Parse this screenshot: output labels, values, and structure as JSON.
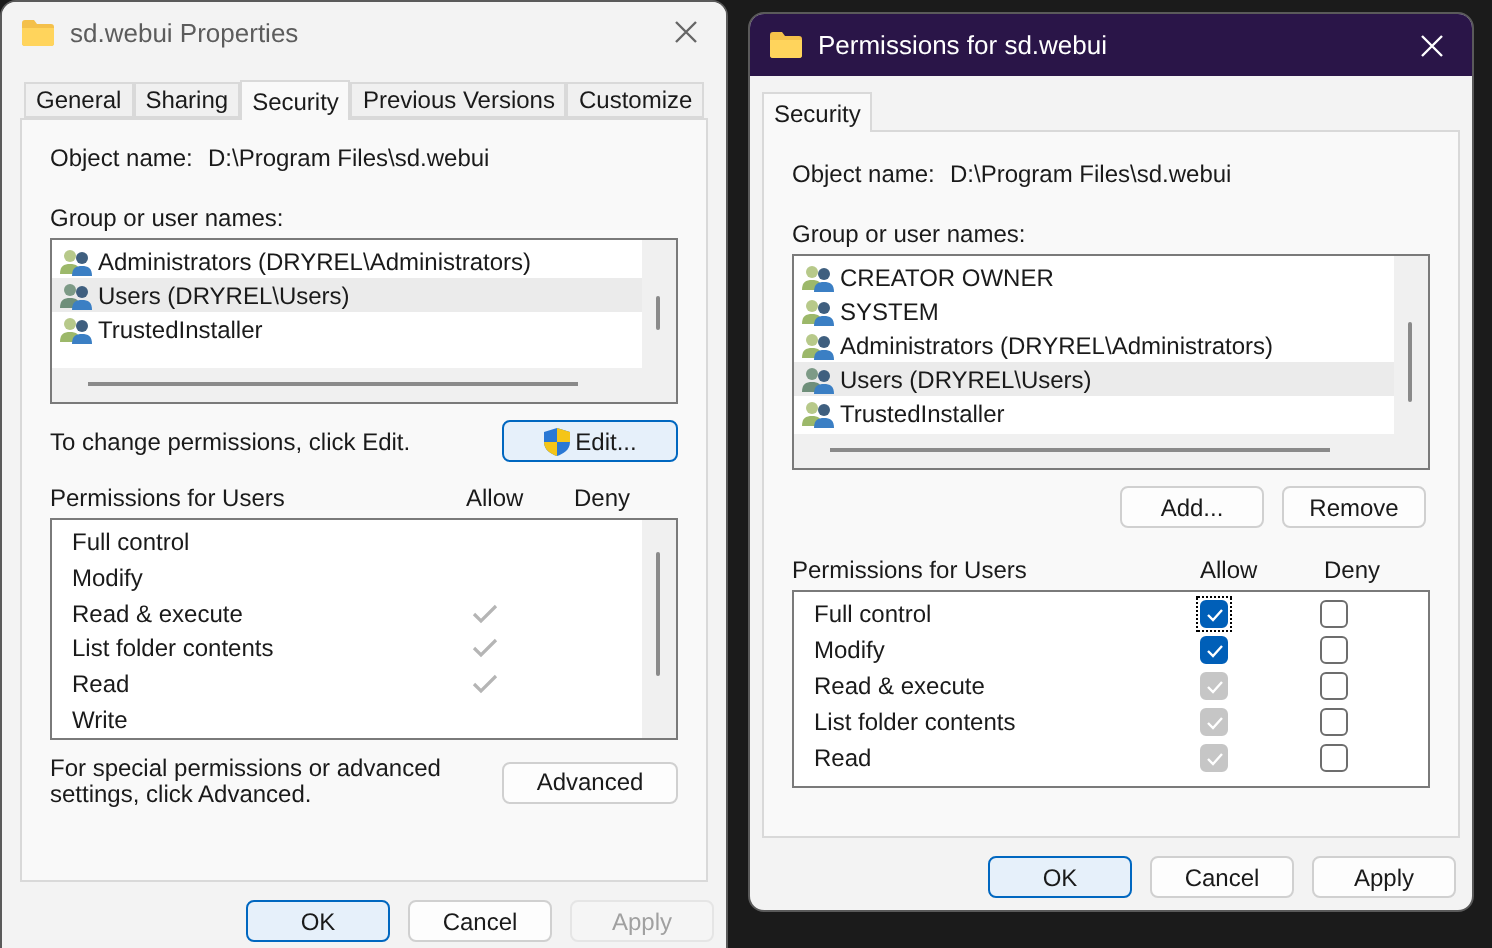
{
  "properties": {
    "title": "sd.webui Properties",
    "tabs": [
      {
        "label": "General",
        "selected": false
      },
      {
        "label": "Sharing",
        "selected": false
      },
      {
        "label": "Security",
        "selected": true
      },
      {
        "label": "Previous Versions",
        "selected": false
      },
      {
        "label": "Customize",
        "selected": false
      }
    ],
    "object_label": "Object name:",
    "object_value": "D:\\Program Files\\sd.webui",
    "group_label": "Group or user names:",
    "principals": [
      {
        "name": "Administrators (DRYREL\\Administrators)",
        "selected": false
      },
      {
        "name": "Users (DRYREL\\Users)",
        "selected": true
      },
      {
        "name": "TrustedInstaller",
        "selected": false
      }
    ],
    "change_hint": "To change permissions, click Edit.",
    "edit_button": "Edit...",
    "permissions_label": "Permissions for Users",
    "allow_header": "Allow",
    "deny_header": "Deny",
    "permissions": [
      {
        "name": "Full control",
        "allow": false
      },
      {
        "name": "Modify",
        "allow": false
      },
      {
        "name": "Read & execute",
        "allow": true
      },
      {
        "name": "List folder contents",
        "allow": true
      },
      {
        "name": "Read",
        "allow": true
      },
      {
        "name": "Write",
        "allow": false
      }
    ],
    "advanced_hint": "For special permissions or advanced settings, click Advanced.",
    "advanced_button": "Advanced",
    "buttons": [
      {
        "label": "OK",
        "disabled": false
      },
      {
        "label": "Cancel",
        "disabled": false
      },
      {
        "label": "Apply",
        "disabled": true
      }
    ]
  },
  "permissions_dialog": {
    "title": "Permissions for sd.webui",
    "tabs": [
      {
        "label": "Security",
        "selected": true
      }
    ],
    "object_label": "Object name:",
    "object_value": "D:\\Program Files\\sd.webui",
    "group_label": "Group or user names:",
    "principals": [
      {
        "name": "CREATOR OWNER",
        "selected": false
      },
      {
        "name": "SYSTEM",
        "selected": false
      },
      {
        "name": "Administrators (DRYREL\\Administrators)",
        "selected": false
      },
      {
        "name": "Users (DRYREL\\Users)",
        "selected": true
      },
      {
        "name": "TrustedInstaller",
        "selected": false
      }
    ],
    "add_button": "Add...",
    "remove_button": "Remove",
    "permissions_label": "Permissions for Users",
    "allow_header": "Allow",
    "deny_header": "Deny",
    "permissions": [
      {
        "name": "Full control",
        "allow": true,
        "deny": false,
        "disabled": false,
        "focused": true
      },
      {
        "name": "Modify",
        "allow": true,
        "deny": false,
        "disabled": false,
        "focused": false
      },
      {
        "name": "Read & execute",
        "allow": true,
        "deny": false,
        "disabled": true,
        "focused": false
      },
      {
        "name": "List folder contents",
        "allow": true,
        "deny": false,
        "disabled": true,
        "focused": false
      },
      {
        "name": "Read",
        "allow": true,
        "deny": false,
        "disabled": true,
        "focused": false
      }
    ],
    "buttons": [
      {
        "label": "OK",
        "disabled": false
      },
      {
        "label": "Cancel",
        "disabled": false
      },
      {
        "label": "Apply",
        "disabled": false
      }
    ]
  }
}
